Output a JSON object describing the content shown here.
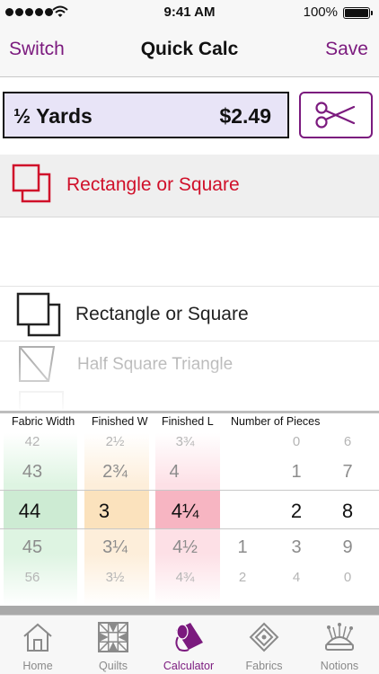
{
  "status_bar": {
    "time": "9:41 AM",
    "battery_percent": "100%",
    "signal_bars": 5,
    "icons": [
      "signal-dots-icon",
      "wifi-icon",
      "battery-icon"
    ]
  },
  "nav": {
    "left_label": "Switch",
    "title": "Quick Calc",
    "right_label": "Save"
  },
  "result": {
    "label": "½ Yards",
    "price": "$2.49",
    "cut_icon": "scissors-icon"
  },
  "selected_shape": {
    "label": "Rectangle or Square",
    "icon": "rectangle-square-icon",
    "color": "#d0102a"
  },
  "shape_picker": {
    "options": [
      {
        "label": "Rectangle or Square",
        "icon": "rectangle-square-icon"
      },
      {
        "label": "Half Square Triangle",
        "icon": "half-square-triangle-icon"
      }
    ]
  },
  "calc_picker": {
    "headers": {
      "fabric_width": "Fabric Width",
      "finished_w": "Finished W",
      "finished_l": "Finished L",
      "number_of_pieces": "Number of Pieces"
    },
    "fabric_width": {
      "rows": [
        "42",
        "43",
        "44",
        "45",
        "56"
      ],
      "selected": "44"
    },
    "finished_w": {
      "rows": [
        "2½",
        "2¾",
        "3",
        "3¼",
        "3½"
      ],
      "selected": "3"
    },
    "finished_l": {
      "rows": [
        "3¾",
        "4",
        "4¼",
        "4½",
        "4¾"
      ],
      "selected": "4¼"
    },
    "pieces_hundreds": {
      "rows": [
        "",
        "",
        "",
        "1",
        "2"
      ],
      "selected": ""
    },
    "pieces_tens": {
      "rows": [
        "0",
        "1",
        "2",
        "3",
        "4"
      ],
      "selected": "2"
    },
    "pieces_ones": {
      "rows": [
        "6",
        "7",
        "8",
        "9",
        "0"
      ],
      "selected": "8"
    },
    "colors": {
      "fabric_width": "#cdebd3",
      "finished_w": "#fbe2bd",
      "finished_l": "#f7b5c2"
    }
  },
  "tabs": [
    {
      "label": "Home",
      "icon": "home-icon",
      "active": false
    },
    {
      "label": "Quilts",
      "icon": "quilt-block-icon",
      "active": false
    },
    {
      "label": "Calculator",
      "icon": "fabric-bolt-icon",
      "active": true
    },
    {
      "label": "Fabrics",
      "icon": "fabric-diamond-icon",
      "active": false
    },
    {
      "label": "Notions",
      "icon": "pincushion-icon",
      "active": false
    }
  ],
  "theme": {
    "accent": "#7b1a7e",
    "selected_red": "#d0102a",
    "result_bg": "#e8e4f7"
  }
}
